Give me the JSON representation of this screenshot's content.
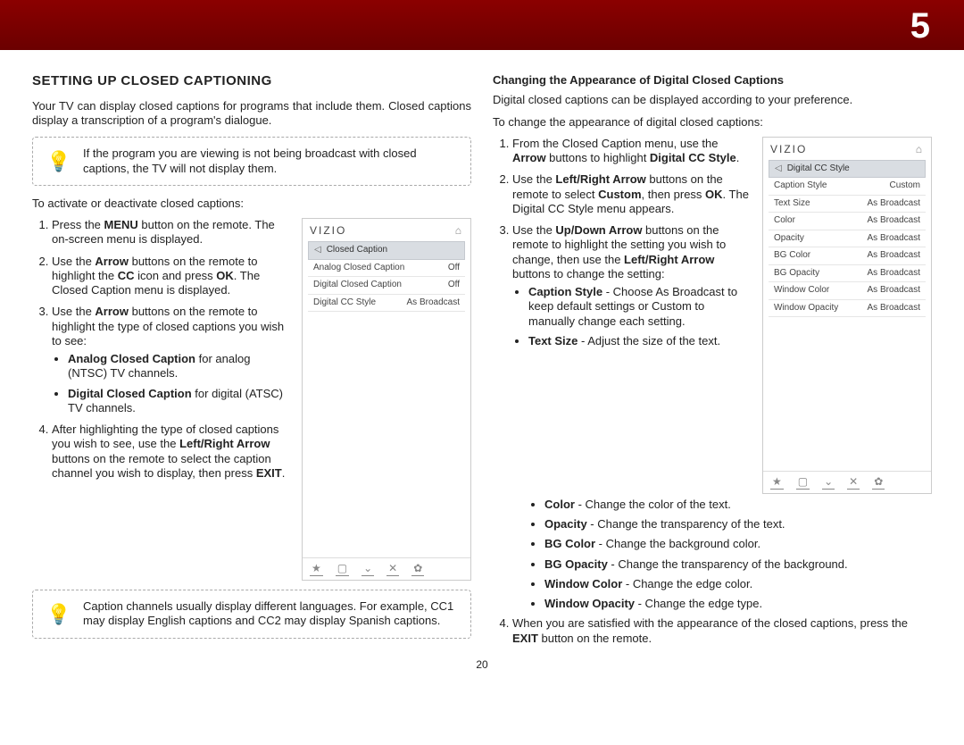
{
  "header": {
    "number": "5"
  },
  "page_number": "20",
  "left": {
    "title": "SETTING UP CLOSED CAPTIONING",
    "intro": "Your TV can display closed captions for programs that include them. Closed captions display a transcription of a program's dialogue.",
    "tip1": "If the program you are viewing is not being broadcast with closed captions, the TV will not display them.",
    "activate_lead": "To activate or deactivate closed captions:",
    "step1_a": "Press the ",
    "step1_b_bold": "MENU",
    "step1_c": " button on the remote. The on-screen menu is displayed.",
    "step2_a": "Use the ",
    "step2_b_bold": "Arrow",
    "step2_c": " buttons on the remote to highlight the ",
    "step2_d_bold": "CC",
    "step2_e": " icon and press ",
    "step2_f_bold": "OK",
    "step2_g": ". The Closed Caption menu is displayed.",
    "step3_a": "Use the ",
    "step3_b_bold": "Arrow",
    "step3_c": " buttons on the remote to highlight the type of closed captions you wish to see:",
    "bullet_a1_bold": "Analog Closed Caption",
    "bullet_a1_rest": " for analog (NTSC) TV channels.",
    "bullet_a2_bold": "Digital Closed Caption",
    "bullet_a2_rest": " for digital (ATSC) TV channels.",
    "step4_a": "After highlighting the type of closed captions you wish to see, use the ",
    "step4_b_bold": "Left/Right Arrow",
    "step4_c": " buttons on the remote to select the caption channel you wish to display, then press ",
    "step4_d_bold": "EXIT",
    "step4_e": ".",
    "tip2": "Caption channels usually display different languages. For example, CC1 may display English captions and CC2 may display Spanish captions."
  },
  "menu_left": {
    "brand": "VIZIO",
    "title": "Closed Caption",
    "rows": [
      {
        "label": "Analog Closed Caption",
        "value": "Off"
      },
      {
        "label": "Digital Closed Caption",
        "value": "Off"
      },
      {
        "label": "Digital CC Style",
        "value": "As Broadcast"
      }
    ],
    "footer": [
      "★",
      "▢",
      "⌄",
      "✕",
      "✿"
    ]
  },
  "right": {
    "subhead": "Changing the Appearance of Digital Closed Captions",
    "intro": "Digital closed captions can be displayed according to your preference.",
    "lead": "To change the appearance of digital closed captions:",
    "step1_a": "From the Closed Caption menu, use the ",
    "step1_b_bold": "Arrow",
    "step1_c": " buttons to highlight ",
    "step1_d_bold": "Digital CC Style",
    "step1_e": ".",
    "step2_a": "Use the ",
    "step2_b_bold": "Left/Right Arrow",
    "step2_c": " buttons on the remote to select ",
    "step2_d_bold": "Custom",
    "step2_e": ", then press ",
    "step2_f_bold": "OK",
    "step2_g": ". The Digital CC Style menu appears.",
    "step3_a": "Use the ",
    "step3_b_bold": "Up/Down Arrow",
    "step3_c": " buttons on the remote to highlight the setting you wish to change, then use the ",
    "step3_d_bold": "Left/Right Arrow",
    "step3_e": " buttons to change the setting:",
    "opts": [
      {
        "bold": "Caption Style",
        "rest": " - Choose As Broadcast to keep default settings or Custom to manually change each setting."
      },
      {
        "bold": "Text Size",
        "rest": " - Adjust the size of the text."
      },
      {
        "bold": "Color",
        "rest": " - Change the color of the text."
      },
      {
        "bold": "Opacity",
        "rest": " - Change the transparency of the text."
      },
      {
        "bold": "BG Color",
        "rest": " - Change the background color."
      },
      {
        "bold": "BG Opacity",
        "rest": " - Change the transparency of the background."
      },
      {
        "bold": "Window Color",
        "rest": " - Change the edge color."
      },
      {
        "bold": "Window Opacity",
        "rest": " - Change the edge type."
      }
    ],
    "step4_a": "When you are satisfied with the appearance of the closed captions, press the ",
    "step4_b_bold": "EXIT",
    "step4_c": " button on the remote."
  },
  "menu_right": {
    "brand": "VIZIO",
    "title": "Digital CC Style",
    "rows": [
      {
        "label": "Caption Style",
        "value": "Custom"
      },
      {
        "label": "Text Size",
        "value": "As Broadcast"
      },
      {
        "label": "Color",
        "value": "As Broadcast"
      },
      {
        "label": "Opacity",
        "value": "As Broadcast"
      },
      {
        "label": "BG Color",
        "value": "As Broadcast"
      },
      {
        "label": "BG Opacity",
        "value": "As Broadcast"
      },
      {
        "label": "Window Color",
        "value": "As Broadcast"
      },
      {
        "label": "Window Opacity",
        "value": "As Broadcast"
      }
    ],
    "footer": [
      "★",
      "▢",
      "⌄",
      "✕",
      "✿"
    ]
  }
}
